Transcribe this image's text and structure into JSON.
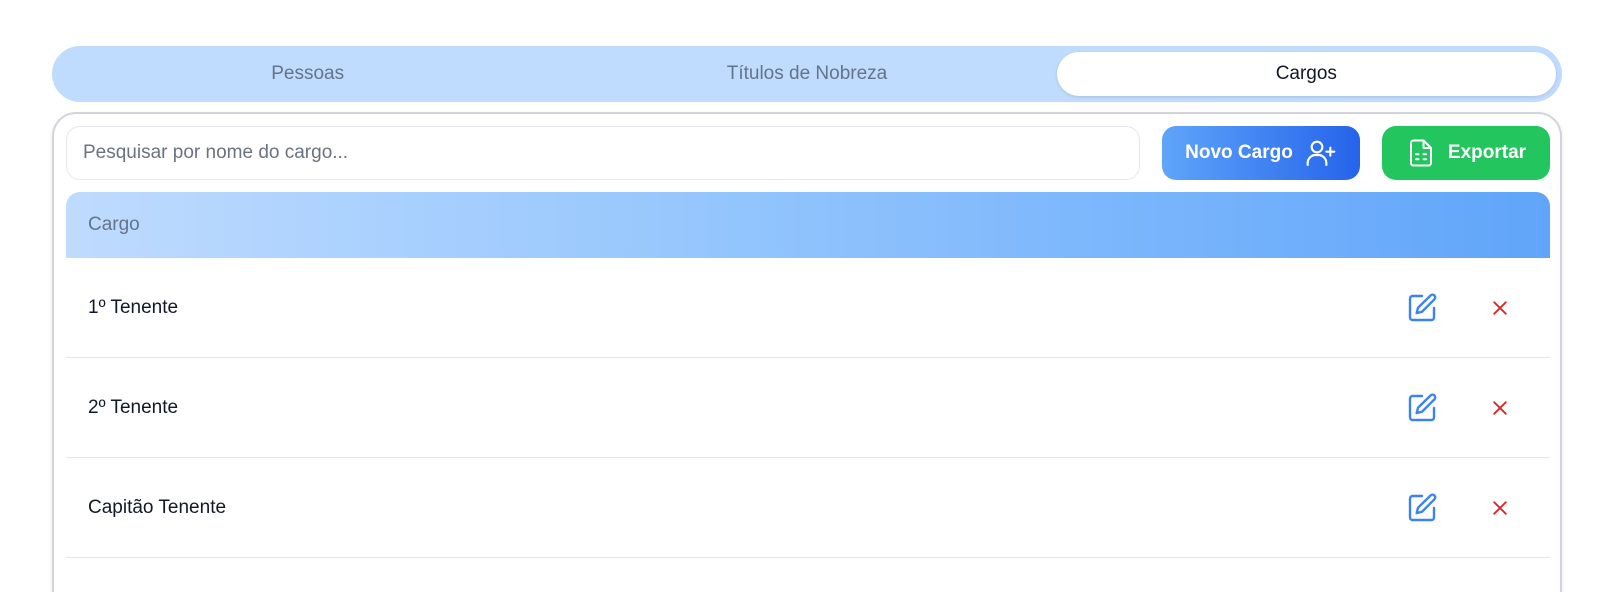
{
  "tabs": [
    {
      "label": "Pessoas",
      "active": false
    },
    {
      "label": "Títulos de Nobreza",
      "active": false
    },
    {
      "label": "Cargos",
      "active": true
    }
  ],
  "search": {
    "placeholder": "Pesquisar por nome do cargo...",
    "value": ""
  },
  "toolbar": {
    "new_label": "Novo Cargo",
    "new_icon": "user-plus-icon",
    "export_label": "Exportar",
    "export_icon": "spreadsheet-file-icon"
  },
  "table": {
    "header": "Cargo",
    "rows": [
      {
        "name": "1º Tenente"
      },
      {
        "name": "2º Tenente"
      },
      {
        "name": "Capitão Tenente"
      }
    ],
    "row_actions": [
      "edit-icon",
      "delete-icon"
    ]
  },
  "colors": {
    "tab_bg": "#bfdbfe",
    "primary": "#2563eb",
    "primary_light": "#60a5fa",
    "export_green": "#22c55e",
    "edit_blue": "#3b82f6",
    "delete_red": "#dc2626"
  }
}
